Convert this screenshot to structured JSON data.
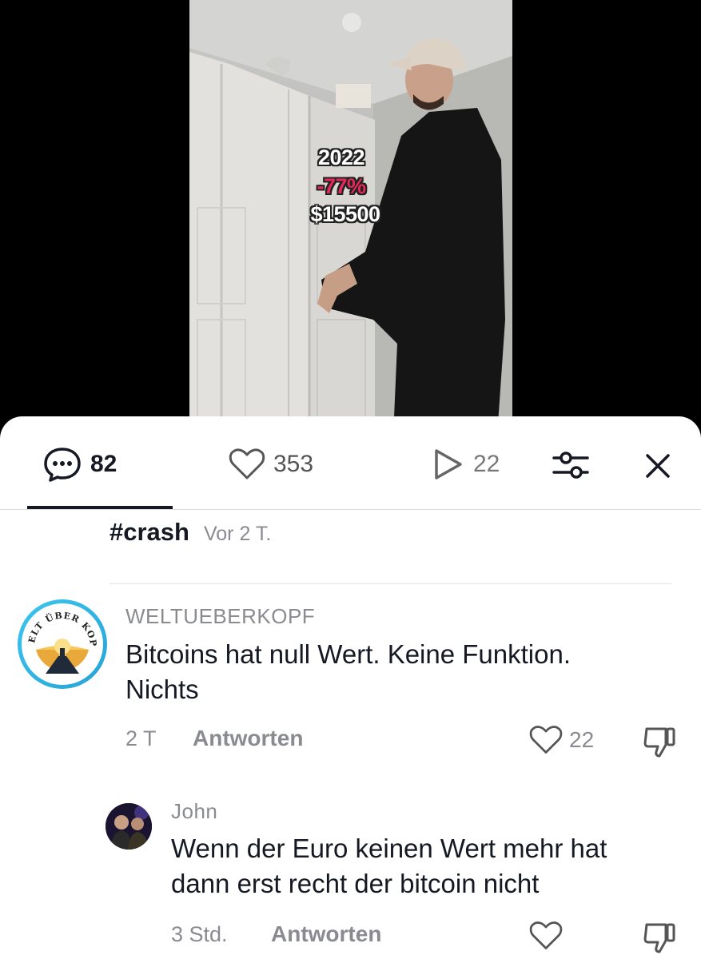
{
  "video": {
    "overlay_year": "2022",
    "overlay_change": "-77%",
    "overlay_price": "$15500"
  },
  "stats": {
    "comments": "82",
    "likes": "353",
    "shares": "22"
  },
  "caption": {
    "hashtag": "#crash",
    "time": "Vor 2 T."
  },
  "comments": [
    {
      "username": "WELTUEBERKOPF",
      "avatar_text": "WELT ÜBER KOPF",
      "text_line1": "Bitcoins hat null Wert. Keine Funktion.",
      "text_line2": "Nichts",
      "time": "2 T",
      "reply_label": "Antworten",
      "likes": "22"
    },
    {
      "username": "John",
      "text_line1": "Wenn der Euro keinen Wert mehr hat",
      "text_line2": "dann erst recht der bitcoin nicht",
      "time": "3 Std.",
      "reply_label": "Antworten",
      "likes": ""
    }
  ],
  "colors": {
    "accent_text": "#161823",
    "muted": "#8a8b91",
    "overlay_red": "#e8285a",
    "avatar_ring": "#3cc6f0"
  }
}
